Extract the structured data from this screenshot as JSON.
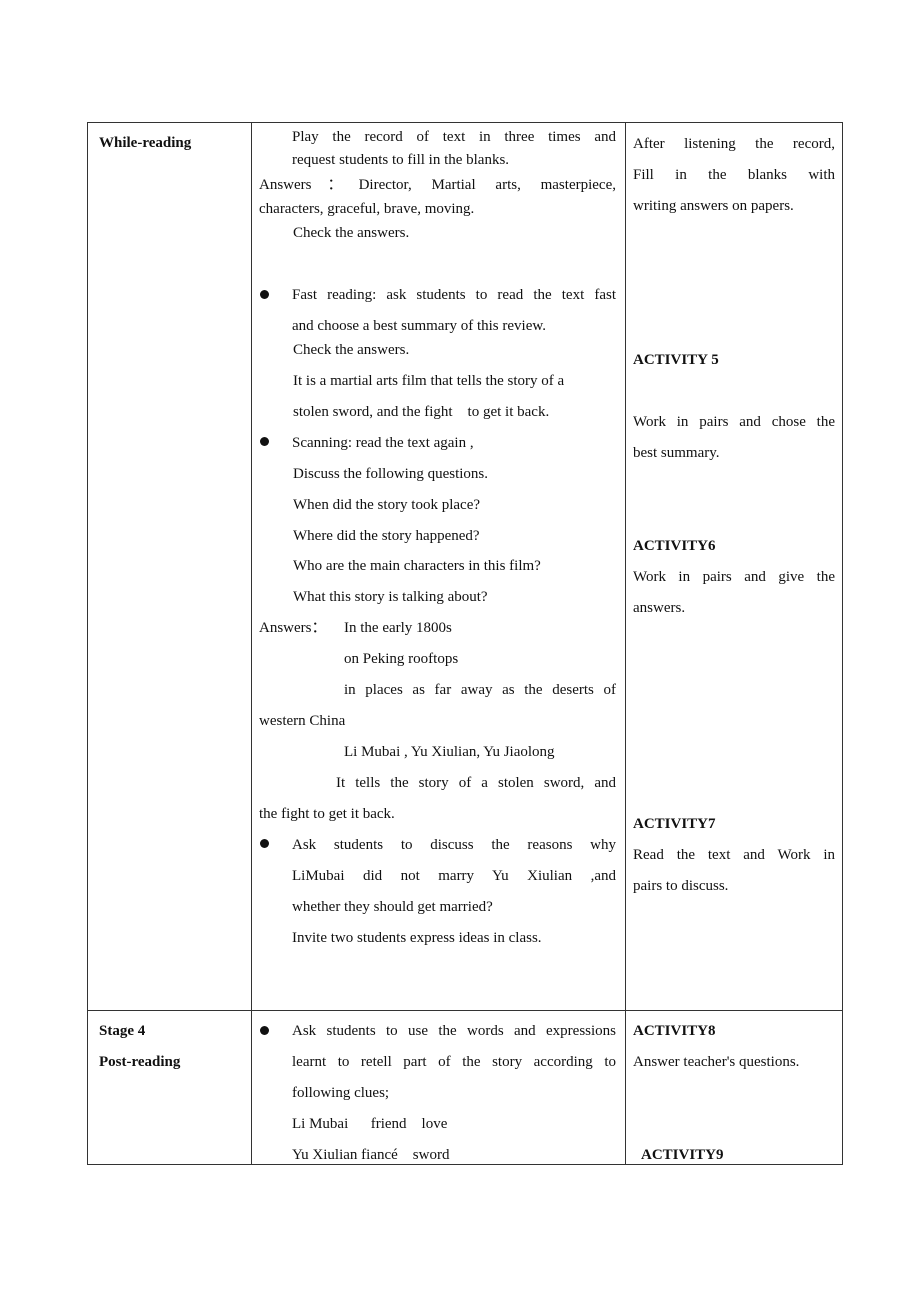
{
  "rows": [
    {
      "stage": {
        "line1": "While-reading"
      },
      "teacher": {
        "intro": [
          "Play the record of text in three times and",
          "request students to fill in the blanks."
        ],
        "answers_line1": "Answers：Director,  Martial  arts,  masterpiece,",
        "answers_line2": "characters, graceful, brave, moving.",
        "check1": "Check the answers.",
        "fast_reading": [
          "Fast reading: ask students to read the text fast",
          "and choose a best summary of this review."
        ],
        "check2": "Check the answers.",
        "summary": [
          "It is a martial arts film that tells the story of a",
          "stolen sword, and the fight    to get it back."
        ],
        "scanning": "Scanning: read the text again ,",
        "discuss": "Discuss the following questions.",
        "questions": [
          "When did the story took place?",
          "Where did the story happened?",
          "Who are the main characters in this film?",
          "What this story is talking about?"
        ],
        "answers_label": "Answers：",
        "answers": [
          "In the early 1800s",
          "on Peking rooftops",
          "in places as far away as the deserts of",
          "western China",
          "Li Mubai , Yu Xiulian, Yu Jiaolong",
          "It tells the story of a stolen sword, and",
          "the fight to get it back."
        ],
        "discuss_reasons": [
          "Ask students to discuss the reasons why",
          "LiMubai did not marry Yu Xiulian ,and",
          "whether they should get married?"
        ],
        "invite": "Invite two students express ideas in class."
      },
      "student": {
        "listen": [
          "After listening the record,",
          "Fill in the blanks with",
          "writing answers on papers."
        ],
        "activity5": "ACTIVITY 5",
        "activity5_text": [
          "Work in pairs and chose the",
          "best summary."
        ],
        "activity6": "ACTIVITY6",
        "activity6_text": [
          "Work in pairs and give the",
          "answers."
        ],
        "activity7": "ACTIVITY7",
        "activity7_text": [
          "Read the text and Work in",
          "pairs to discuss."
        ]
      }
    },
    {
      "stage": {
        "line1": "Stage 4",
        "line2": "Post-reading"
      },
      "teacher": {
        "retell": [
          "Ask students to use the words and expressions",
          "learnt to retell part of the story according to",
          "following clues;"
        ],
        "clues": [
          "Li Mubai      friend    love",
          "Yu Xiulian fiancé    sword"
        ]
      },
      "student": {
        "activity8": "ACTIVITY8",
        "activity8_text": "Answer teacher's questions.",
        "activity9": "ACTIVITY9"
      }
    }
  ]
}
